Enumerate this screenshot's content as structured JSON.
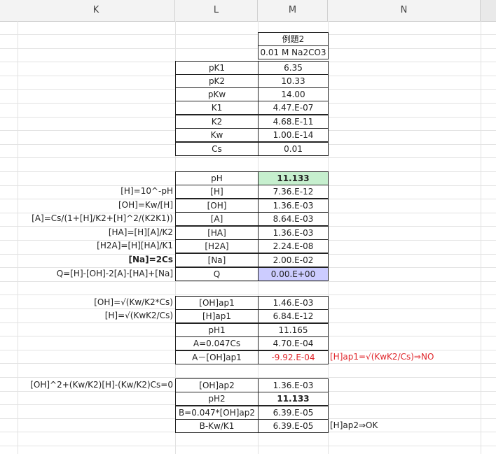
{
  "columns": [
    "K",
    "L",
    "M",
    "N"
  ],
  "header_block": {
    "title": "例題2",
    "subtitle": "0.01 M Na2CO3"
  },
  "constants": [
    {
      "label": "pK1",
      "value": "6.35"
    },
    {
      "label": "pK2",
      "value": "10.33"
    },
    {
      "label": "pKw",
      "value": "14.00"
    },
    {
      "label": "K1",
      "value": "4.47.E-07"
    },
    {
      "label": "K2",
      "value": "4.68.E-11"
    },
    {
      "label": "Kw",
      "value": "1.00.E-14"
    },
    {
      "label": "Cs",
      "value": "0.01"
    }
  ],
  "equilibrium": [
    {
      "formula": "",
      "label": "pH",
      "value": "11.133"
    },
    {
      "formula": "[H]=10^-pH",
      "label": "[H]",
      "value": "7.36.E-12"
    },
    {
      "formula": "[OH]=Kw/[H]",
      "label": "[OH]",
      "value": "1.36.E-03"
    },
    {
      "formula": "[A]=Cs/(1+[H]/K2+[H]^2/(K2K1))",
      "label": "[A]",
      "value": "8.64.E-03"
    },
    {
      "formula": "[HA]=[H][A]/K2",
      "label": "[HA]",
      "value": "1.36.E-03"
    },
    {
      "formula": "[H2A]=[H][HA]/K1",
      "label": "[H2A]",
      "value": "2.24.E-08"
    },
    {
      "formula": "[Na]=2Cs",
      "label": "[Na]",
      "value": "2.00.E-02"
    },
    {
      "formula": "Q=[H]-[OH]-2[A]-[HA]+[Na]",
      "label": "Q",
      "value": "0.00.E+00"
    }
  ],
  "approx1": [
    {
      "formula": "[OH]=√(Kw/K2*Cs)",
      "label": "[OH]ap1",
      "value": "1.46.E-03",
      "note": ""
    },
    {
      "formula": "[H]=√(KwK2/Cs)",
      "label": "[H]ap1",
      "value": "6.84.E-12",
      "note": ""
    },
    {
      "formula": "",
      "label": "pH1",
      "value": "11.165",
      "note": ""
    },
    {
      "formula": "",
      "label": "A=0.047Cs",
      "value": "4.70.E-04",
      "note": ""
    },
    {
      "formula": "",
      "label": "A－[OH]ap1",
      "value": "-9.92.E-04",
      "note": "[H]ap1=√(KwK2/Cs)⇒NO"
    }
  ],
  "approx2": [
    {
      "formula": "[OH]^2+(Kw/K2)[H]-(Kw/K2)Cs=0",
      "label": "[OH]ap2",
      "value": "1.36.E-03",
      "note": ""
    },
    {
      "formula": "",
      "label": "pH2",
      "value": "11.133",
      "note": ""
    },
    {
      "formula": "",
      "label": "B=0.047*[OH]ap2",
      "value": "6.39.E-05",
      "note": ""
    },
    {
      "formula": "",
      "label": "B-Kw/K1",
      "value": "6.39.E-05",
      "note": "[H]ap2⇒OK"
    }
  ],
  "colors": {
    "highlight_green": "#c6efce",
    "highlight_lavender": "#ccccff",
    "negative_red": "#e0262b"
  }
}
